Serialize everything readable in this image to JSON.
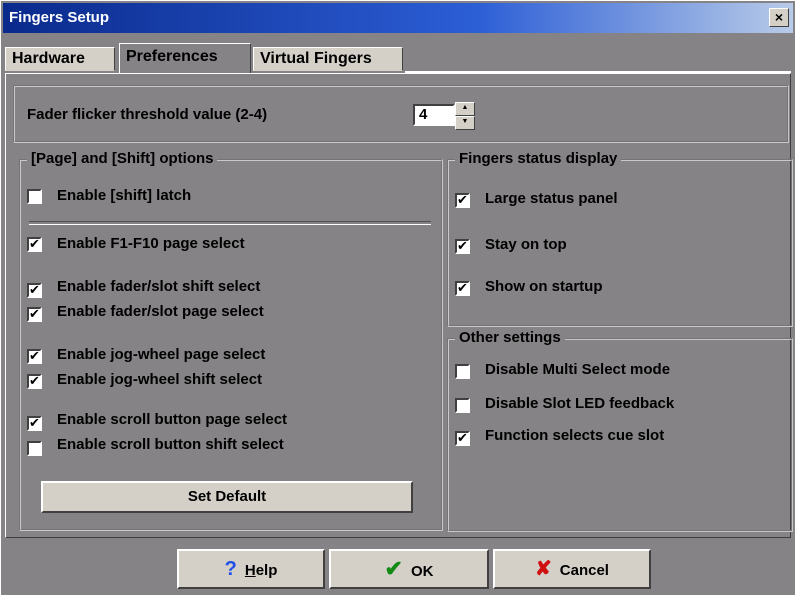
{
  "window": {
    "title": "Fingers Setup",
    "close_glyph": "×"
  },
  "tabs": [
    "Hardware",
    "Preferences",
    "Virtual Fingers"
  ],
  "active_tab": "Preferences",
  "threshold": {
    "label": "Fader flicker threshold value (2-4)",
    "value": "4"
  },
  "page_shift": {
    "title": "[Page] and  [Shift] options",
    "shift_latch": {
      "label": "Enable [shift] latch",
      "checked": false
    },
    "items": [
      {
        "label": "Enable F1-F10 page select",
        "checked": true
      },
      {
        "label": "Enable fader/slot shift select",
        "checked": true
      },
      {
        "label": "Enable fader/slot page select",
        "checked": true
      },
      {
        "label": "Enable jog-wheel page select",
        "checked": true
      },
      {
        "label": "Enable jog-wheel shift select",
        "checked": true
      },
      {
        "label": "Enable scroll button page select",
        "checked": true
      },
      {
        "label": "Enable scroll button shift select",
        "checked": false
      }
    ],
    "default_button": "Set Default"
  },
  "status_display": {
    "title": "Fingers status display",
    "items": [
      {
        "label": "Large status panel",
        "checked": true
      },
      {
        "label": "Stay on top",
        "checked": true
      },
      {
        "label": "Show on startup",
        "checked": true
      }
    ]
  },
  "other_settings": {
    "title": "Other settings",
    "items": [
      {
        "label": "Disable Multi Select mode",
        "checked": false
      },
      {
        "label": "Disable Slot LED feedback",
        "checked": false
      },
      {
        "label": "Function selects cue slot",
        "checked": true
      }
    ]
  },
  "buttons": {
    "help_icon": "question-mark",
    "help_label": "Help",
    "ok_icon": "check-mark",
    "ok_label": "OK",
    "cancel_icon": "x-mark",
    "cancel_label": "Cancel"
  },
  "check_glyph": "✔"
}
